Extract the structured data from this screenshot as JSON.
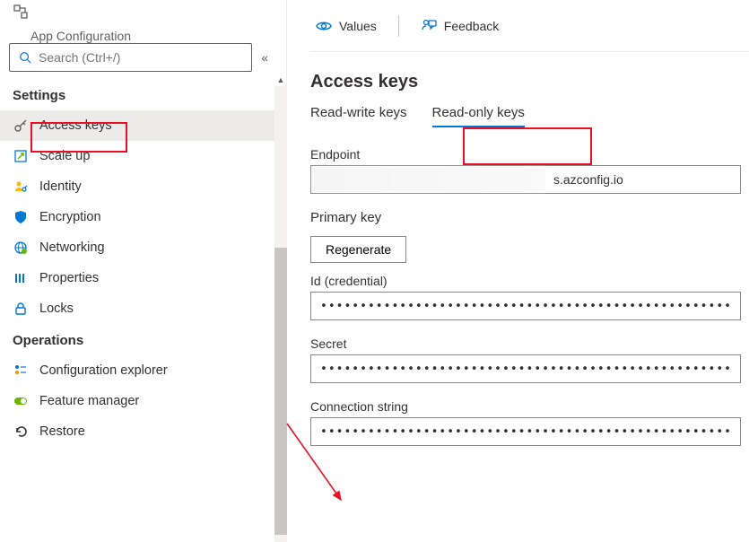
{
  "header": {
    "subtitle": "App Configuration"
  },
  "search": {
    "placeholder": "Search (Ctrl+/)"
  },
  "sections": {
    "settings_title": "Settings",
    "operations_title": "Operations"
  },
  "sidebar": {
    "settings": [
      {
        "label": "Access keys",
        "icon": "key-icon",
        "active": true
      },
      {
        "label": "Scale up",
        "icon": "scale-icon"
      },
      {
        "label": "Identity",
        "icon": "identity-icon"
      },
      {
        "label": "Encryption",
        "icon": "shield-icon"
      },
      {
        "label": "Networking",
        "icon": "globe-icon"
      },
      {
        "label": "Properties",
        "icon": "properties-icon"
      },
      {
        "label": "Locks",
        "icon": "lock-icon"
      }
    ],
    "operations": [
      {
        "label": "Configuration explorer",
        "icon": "config-icon"
      },
      {
        "label": "Feature manager",
        "icon": "feature-icon"
      },
      {
        "label": "Restore",
        "icon": "restore-icon"
      }
    ]
  },
  "toolbar": {
    "values": "Values",
    "feedback": "Feedback"
  },
  "page": {
    "title": "Access keys",
    "tabs": {
      "rw": "Read-write keys",
      "ro": "Read-only keys"
    },
    "endpoint_label": "Endpoint",
    "endpoint_value_suffix": "s.azconfig.io",
    "primary_key_label": "Primary key",
    "regenerate": "Regenerate",
    "id_label": "Id (credential)",
    "secret_label": "Secret",
    "conn_label": "Connection string",
    "masked": "•••••••••••••••••••••••••••••••••••••••••••••••••••••••••••••••••••••••••••••••••••••"
  }
}
